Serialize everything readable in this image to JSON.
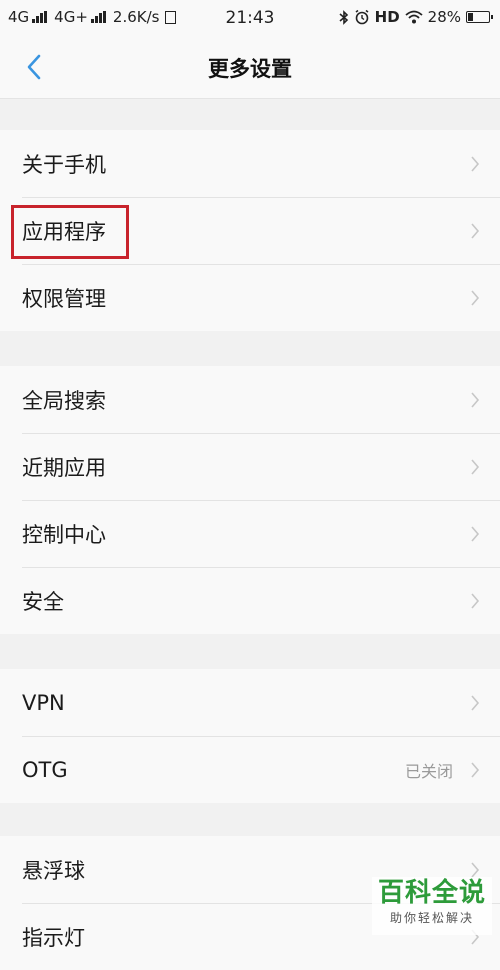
{
  "status_bar": {
    "sim1": "4G",
    "sim2": "4G+",
    "speed": "2.6K/s",
    "sim_card_glyph": "",
    "time": "21:43",
    "hd": "HD",
    "battery_percent": "28%",
    "battery_level": 0.28
  },
  "nav": {
    "title": "更多设置"
  },
  "groups": [
    {
      "items": [
        {
          "label": "关于手机"
        },
        {
          "label": "应用程序",
          "highlighted": true
        },
        {
          "label": "权限管理"
        }
      ]
    },
    {
      "items": [
        {
          "label": "全局搜索"
        },
        {
          "label": "近期应用"
        },
        {
          "label": "控制中心"
        },
        {
          "label": "安全"
        }
      ]
    },
    {
      "items": [
        {
          "label": "VPN"
        },
        {
          "label": "OTG",
          "value": "已关闭"
        }
      ]
    },
    {
      "items": [
        {
          "label": "悬浮球"
        },
        {
          "label": "指示灯"
        }
      ]
    }
  ],
  "watermark": {
    "title": "百科全说",
    "subtitle": "助你轻松解决"
  },
  "colors": {
    "accent": "#3a95e0",
    "highlight_border": "#c8232c",
    "watermark_green": "#2d9b3a"
  }
}
